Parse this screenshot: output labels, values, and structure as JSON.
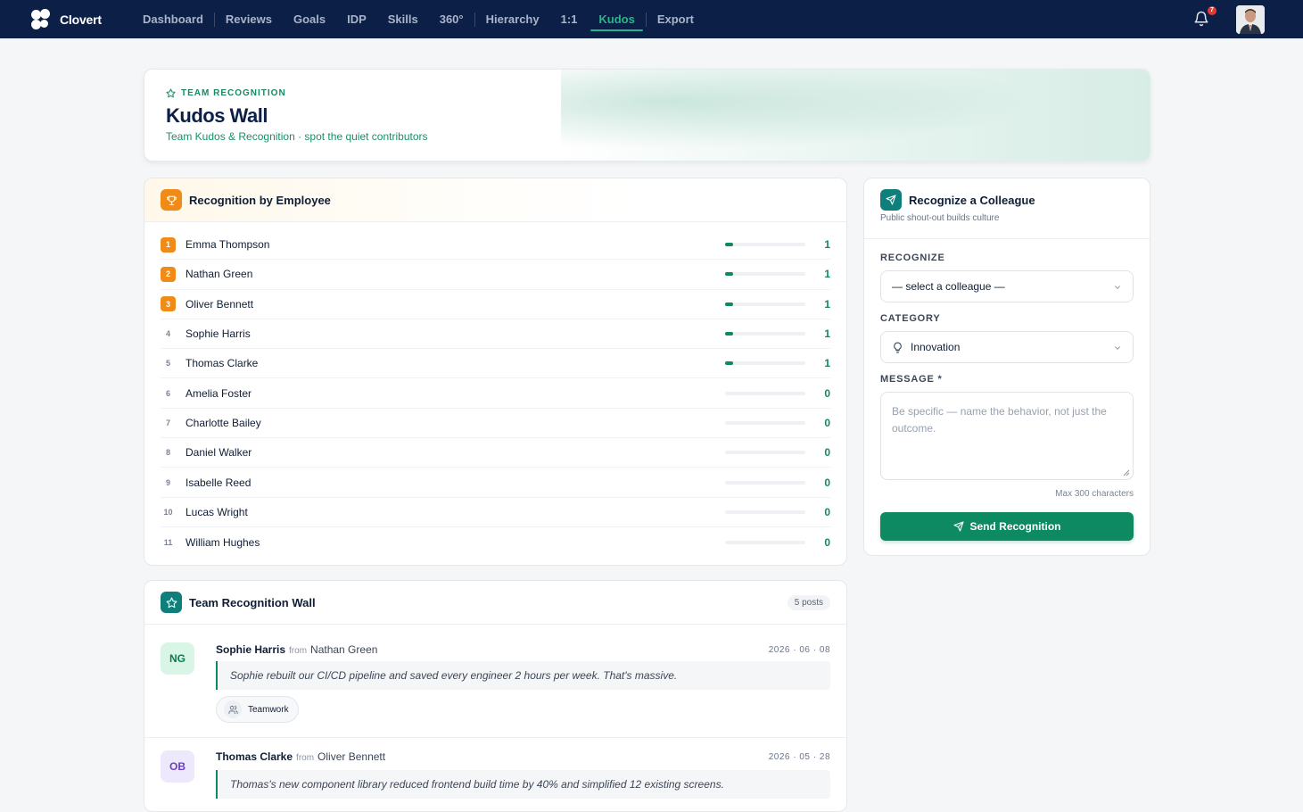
{
  "app": {
    "brand": "Clovert",
    "nav": [
      "Dashboard",
      "Reviews",
      "Goals",
      "IDP",
      "Skills",
      "360°",
      "Hierarchy",
      "1:1",
      "Kudos",
      "Export"
    ],
    "active_nav": "Kudos",
    "notifications_count": "7"
  },
  "hero": {
    "eyebrow": "TEAM RECOGNITION",
    "title": "Kudos Wall",
    "subtitle": "Team Kudos & Recognition · spot the quiet contributors"
  },
  "leaderboard": {
    "title": "Recognition by Employee",
    "rows": [
      {
        "rank": "1",
        "name": "Emma Thompson",
        "count": "1",
        "fill": 0.1
      },
      {
        "rank": "2",
        "name": "Nathan Green",
        "count": "1",
        "fill": 0.1
      },
      {
        "rank": "3",
        "name": "Oliver Bennett",
        "count": "1",
        "fill": 0.1
      },
      {
        "rank": "4",
        "name": "Sophie Harris",
        "count": "1",
        "fill": 0.1
      },
      {
        "rank": "5",
        "name": "Thomas Clarke",
        "count": "1",
        "fill": 0.1
      },
      {
        "rank": "6",
        "name": "Amelia Foster",
        "count": "0",
        "fill": 0
      },
      {
        "rank": "7",
        "name": "Charlotte Bailey",
        "count": "0",
        "fill": 0
      },
      {
        "rank": "8",
        "name": "Daniel Walker",
        "count": "0",
        "fill": 0
      },
      {
        "rank": "9",
        "name": "Isabelle Reed",
        "count": "0",
        "fill": 0
      },
      {
        "rank": "10",
        "name": "Lucas Wright",
        "count": "0",
        "fill": 0
      },
      {
        "rank": "11",
        "name": "William Hughes",
        "count": "0",
        "fill": 0
      }
    ]
  },
  "recognize": {
    "title": "Recognize a Colleague",
    "subtitle": "Public shout-out builds culture",
    "recognize_label": "RECOGNIZE",
    "recognize_value": "— select a colleague —",
    "category_label": "CATEGORY",
    "category_value": "Innovation",
    "message_label": "MESSAGE *",
    "message_placeholder": "Be specific — name the behavior, not just the outcome.",
    "max_chars": "Max 300 characters",
    "send_label": "Send Recognition"
  },
  "wall": {
    "title": "Team Recognition Wall",
    "posts_badge": "5 posts",
    "from_word": "from",
    "posts": [
      {
        "initials": "NG",
        "to": "Sophie Harris",
        "from": "Nathan Green",
        "date": "2026 · 06 · 08",
        "message": "Sophie rebuilt our CI/CD pipeline and saved every engineer 2 hours per week. That's massive.",
        "tag": "Teamwork"
      },
      {
        "initials": "OB",
        "to": "Thomas Clarke",
        "from": "Oliver Bennett",
        "date": "2026 · 05 · 28",
        "message": "Thomas's new component library reduced frontend build time by 40% and simplified 12 existing screens."
      }
    ]
  },
  "colors": {
    "nav_bg": "#0b1f47",
    "accent": "#0e8a62",
    "rank_orange": "#ef8b16"
  }
}
